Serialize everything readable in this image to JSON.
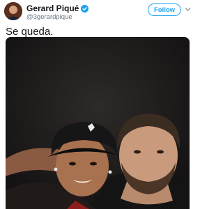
{
  "tweet": {
    "author": {
      "display_name": "Gerard Piqué",
      "handle": "@3gerardpique",
      "verified": true,
      "avatar_icon": "profile-avatar"
    },
    "follow_label": "Follow",
    "text": "Se queda.",
    "media": {
      "type": "photo",
      "description_icon": "selfie-photo"
    }
  },
  "colors": {
    "accent": "#1da1f2",
    "handle": "#657786",
    "text": "#14171a"
  }
}
